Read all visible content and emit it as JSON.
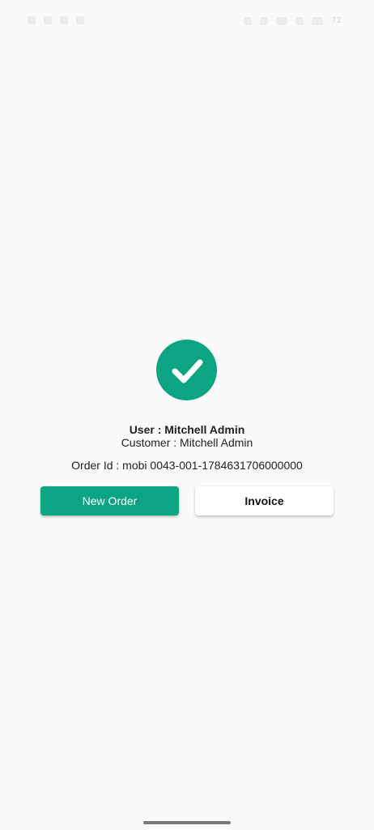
{
  "status_bar": {
    "battery_level": "72"
  },
  "success": {
    "icon": "check-circle-icon",
    "color": "#0da483"
  },
  "info": {
    "user_line": "User : Mitchell Admin",
    "customer_line": "Customer : Mitchell Admin",
    "order_line": "Order Id : mobi 0043-001-1784631706000000"
  },
  "actions": {
    "new_order_label": "New Order",
    "invoice_label": "Invoice"
  }
}
